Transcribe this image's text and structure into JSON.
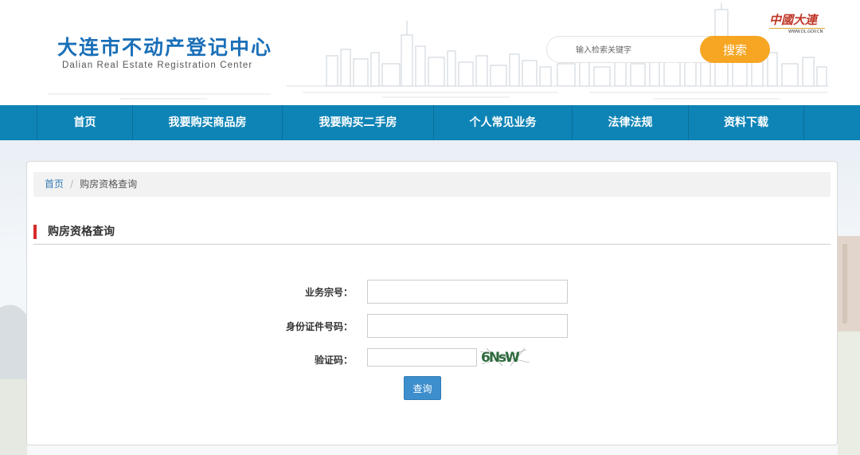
{
  "header": {
    "title_cn": "大连市不动产登记中心",
    "title_en": "Dalian Real Estate Registration Center",
    "search_placeholder": "输入检索关键字",
    "search_button": "搜索",
    "city_logo_text": "中國大連",
    "city_logo_url": "WWW.DL.GOV.CN"
  },
  "nav": {
    "items": [
      {
        "label": "首页"
      },
      {
        "label": "我要购买商品房"
      },
      {
        "label": "我要购买二手房"
      },
      {
        "label": "个人常见业务"
      },
      {
        "label": "法律法规"
      },
      {
        "label": "资料下载"
      }
    ]
  },
  "breadcrumb": {
    "home": "首页",
    "separator": "/",
    "current": "购房资格查询"
  },
  "section": {
    "title": "购房资格查询"
  },
  "form": {
    "business_no_label": "业务宗号：",
    "business_no_value": "",
    "id_no_label": "身份证件号码：",
    "id_no_value": "",
    "captcha_label": "验证码：",
    "captcha_value": "",
    "captcha_text": "6NsW",
    "submit_label": "查询"
  },
  "colors": {
    "nav_bg": "#0e84b6",
    "search_button": "#f6a623",
    "title_blue": "#1a6fb8",
    "accent_red": "#d72b2b",
    "submit_blue": "#3d8ecd"
  }
}
